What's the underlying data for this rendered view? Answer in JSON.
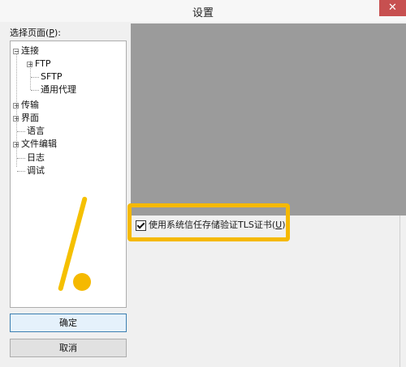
{
  "window": {
    "title": "设置",
    "close_glyph": "✕"
  },
  "left": {
    "label_prefix": "选择页面(",
    "label_accel": "P",
    "label_suffix": "):"
  },
  "tree": {
    "items": [
      {
        "label": "连接",
        "expander": "−"
      },
      {
        "label": "FTP",
        "expander": "+"
      },
      {
        "label": "SFTP"
      },
      {
        "label": "通用代理"
      },
      {
        "label": "传输",
        "expander": "+"
      },
      {
        "label": "界面",
        "expander": "+"
      },
      {
        "label": "语言"
      },
      {
        "label": "文件编辑",
        "expander": "+"
      },
      {
        "label": "日志"
      },
      {
        "label": "调试"
      }
    ]
  },
  "buttons": {
    "ok_label": "确定",
    "cancel_label": "取消"
  },
  "options": {
    "trust_store": {
      "label_prefix": "使用系统信任存储验证TLS证书(",
      "label_accel": "U",
      "label_suffix": ")",
      "checked": true
    }
  },
  "colors": {
    "accent_highlight": "#f5b900",
    "close_button": "#c75050"
  }
}
